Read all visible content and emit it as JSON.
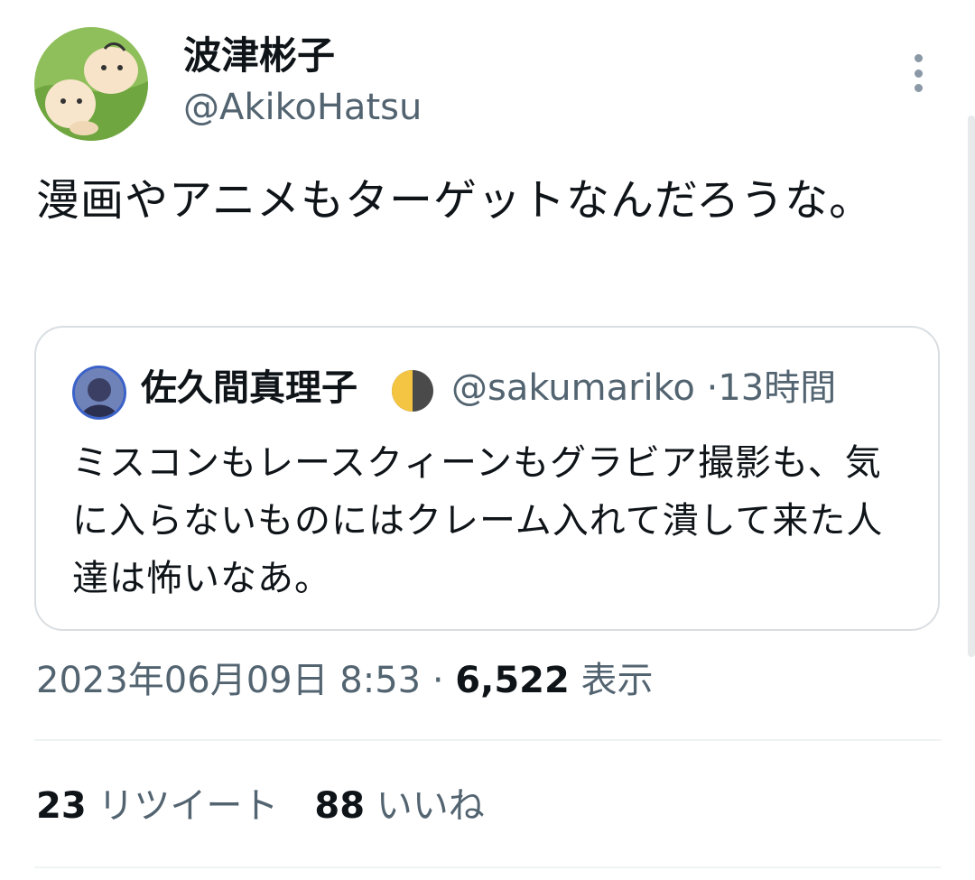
{
  "tweet": {
    "display_name": "波津彬子",
    "handle": "@AkikoHatsu",
    "text": "漫画やアニメもターゲットなんだろうな。",
    "timestamp": "2023年06月09日 8:53",
    "separator": "·",
    "views_count": "6,522",
    "views_label": "表示"
  },
  "quoted_tweet": {
    "display_name": "佐久間真理子",
    "emoji": "🌓",
    "handle": "@sakumariko",
    "age": "13時間",
    "text": "ミスコンもレースクィーンもグラビア撮影も、気に入らないものにはクレーム入れて潰して来た人達は怖いなあ。"
  },
  "stats": {
    "retweets_count": "23",
    "retweets_label": "リツイート",
    "likes_count": "88",
    "likes_label": "いいね"
  },
  "icons": {
    "more": "more-vertical-icon",
    "moon": "first-quarter-moon-icon"
  },
  "colors": {
    "text": "#0f1419",
    "secondary": "#536471",
    "border": "#d9dee2"
  }
}
